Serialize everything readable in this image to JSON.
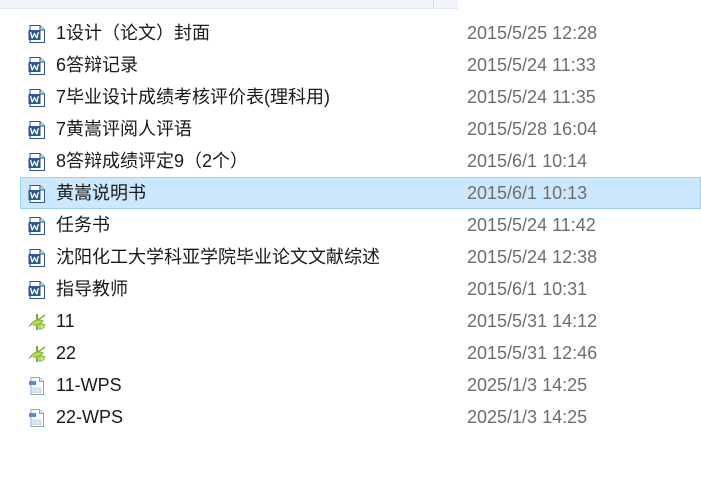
{
  "files": [
    {
      "name": "1设计（论文）封面",
      "date": "2015/5/25 12:28",
      "icon": "word-doc-icon",
      "selected": false
    },
    {
      "name": "6答辩记录",
      "date": "2015/5/24 11:33",
      "icon": "word-doc-icon",
      "selected": false
    },
    {
      "name": "7毕业设计成绩考核评价表(理科用)",
      "date": "2015/5/24 11:35",
      "icon": "word-doc-icon",
      "selected": false
    },
    {
      "name": "7黄嵩评阅人评语",
      "date": "2015/5/28 16:04",
      "icon": "word-doc-icon",
      "selected": false
    },
    {
      "name": "8答辩成绩评定9（2个）",
      "date": "2015/6/1 10:14",
      "icon": "word-doc-icon",
      "selected": false
    },
    {
      "name": "黄嵩说明书",
      "date": "2015/6/1 10:13",
      "icon": "word-doc-icon",
      "selected": true
    },
    {
      "name": "任务书",
      "date": "2015/5/24 11:42",
      "icon": "word-doc-icon",
      "selected": false
    },
    {
      "name": "沈阳化工大学科亚学院毕业论文文献综述",
      "date": "2015/5/24 12:38",
      "icon": "word-doc-icon",
      "selected": false
    },
    {
      "name": "指导教师",
      "date": "2015/6/1 10:31",
      "icon": "word-doc-icon",
      "selected": false
    },
    {
      "name": "11",
      "date": "2015/5/31 14:12",
      "icon": "cad-drawing-icon",
      "selected": false
    },
    {
      "name": "22",
      "date": "2015/5/31 12:46",
      "icon": "cad-drawing-icon",
      "selected": false
    },
    {
      "name": "11-WPS",
      "date": "2025/1/3 14:25",
      "icon": "jpg-image-icon",
      "selected": false
    },
    {
      "name": "22-WPS",
      "date": "2025/1/3 14:25",
      "icon": "jpg-image-icon",
      "selected": false
    }
  ],
  "colors": {
    "selection_bg": "#cce8ff",
    "selection_border": "#99d1ff",
    "word_blue": "#2b579a",
    "cad_green": "#8ab832"
  }
}
